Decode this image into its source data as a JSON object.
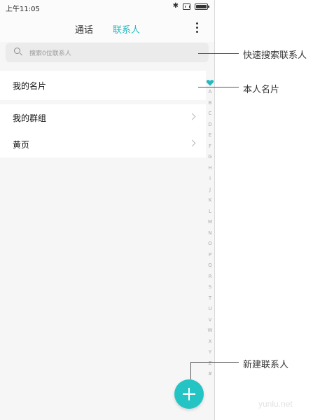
{
  "status_bar": {
    "time": "上午11:05",
    "icons": [
      "bluetooth-icon",
      "sim-icon",
      "battery-icon"
    ]
  },
  "header": {
    "tabs": [
      {
        "label": "通话",
        "active": false
      },
      {
        "label": "联系人",
        "active": true
      }
    ],
    "more_icon": "more-vertical-icon"
  },
  "search": {
    "placeholder": "搜索0位联系人",
    "icon": "search-icon"
  },
  "my_card": {
    "label": "我的名片"
  },
  "menu": {
    "items": [
      {
        "label": "我的群组"
      },
      {
        "label": "黄页"
      }
    ]
  },
  "index_bar": {
    "favorite_icon": "heart-icon",
    "letters": [
      "A",
      "B",
      "C",
      "D",
      "E",
      "F",
      "G",
      "H",
      "I",
      "J",
      "K",
      "L",
      "M",
      "N",
      "O",
      "P",
      "Q",
      "R",
      "S",
      "T",
      "U",
      "V",
      "W",
      "X",
      "Y",
      "Z",
      "#"
    ]
  },
  "fab": {
    "icon": "plus-icon"
  },
  "callouts": {
    "search": "快速搜索联系人",
    "my_card": "本人名片",
    "new_contact": "新建联系人"
  },
  "watermark": "yunlu.net",
  "colors": {
    "accent": "#25b9c0",
    "fab": "#25c4c4",
    "background": "#f6f6f6"
  }
}
